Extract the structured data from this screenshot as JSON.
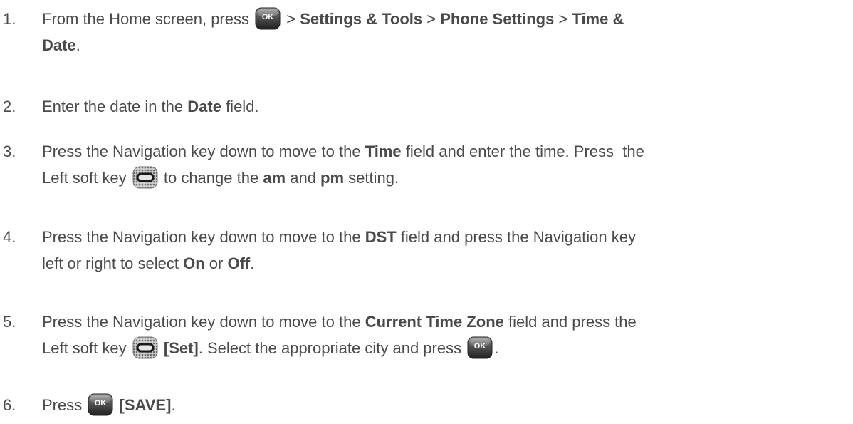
{
  "steps": [
    {
      "number": "1.",
      "parts": {
        "a": "From the Home screen, press",
        "ok_key": "OK",
        "b": " > ",
        "c": "Settings & Tools",
        "d": " > ",
        "e": "Phone Settings",
        "f": " > ",
        "g": "Time &",
        "h": "Date",
        "i": "."
      }
    },
    {
      "number": "2.",
      "parts": {
        "a": "Enter the date in the ",
        "b": "Date",
        "c": " field."
      }
    },
    {
      "number": "3.",
      "parts": {
        "a": "Press the Navigation key down to move to the ",
        "b": "Time",
        "c": " field and enter the time. Press  the",
        "d": "Left soft key",
        "e": " to change the ",
        "f": "am",
        "g": " and ",
        "h": "pm",
        "i": " setting."
      }
    },
    {
      "number": "4.",
      "parts": {
        "a": "Press the Navigation key down to move to the ",
        "b": "DST",
        "c": " field and press the Navigation key",
        "d": "left or right to select ",
        "e": "On",
        "f": " or ",
        "g": "Off",
        "h": "."
      }
    },
    {
      "number": "5.",
      "parts": {
        "a": "Press the Navigation key down to move to the ",
        "b": "Current Time Zone",
        "c": " field and press the",
        "d": "Left soft key",
        "e": "[Set]",
        "f": ". Select the appropriate city and press",
        "ok_key": "OK",
        "g": "."
      }
    },
    {
      "number": "6.",
      "parts": {
        "a": "Press",
        "ok_key": "OK",
        "b": "[SAVE]",
        "c": "."
      }
    }
  ],
  "icons": {
    "ok_key": "ok-key-icon",
    "left_soft_key": "left-soft-key-icon"
  },
  "colors": {
    "text": "#4a4a4a",
    "ok_key_dark": "#2e2e2e",
    "ok_key_light": "#9a9a9a"
  }
}
